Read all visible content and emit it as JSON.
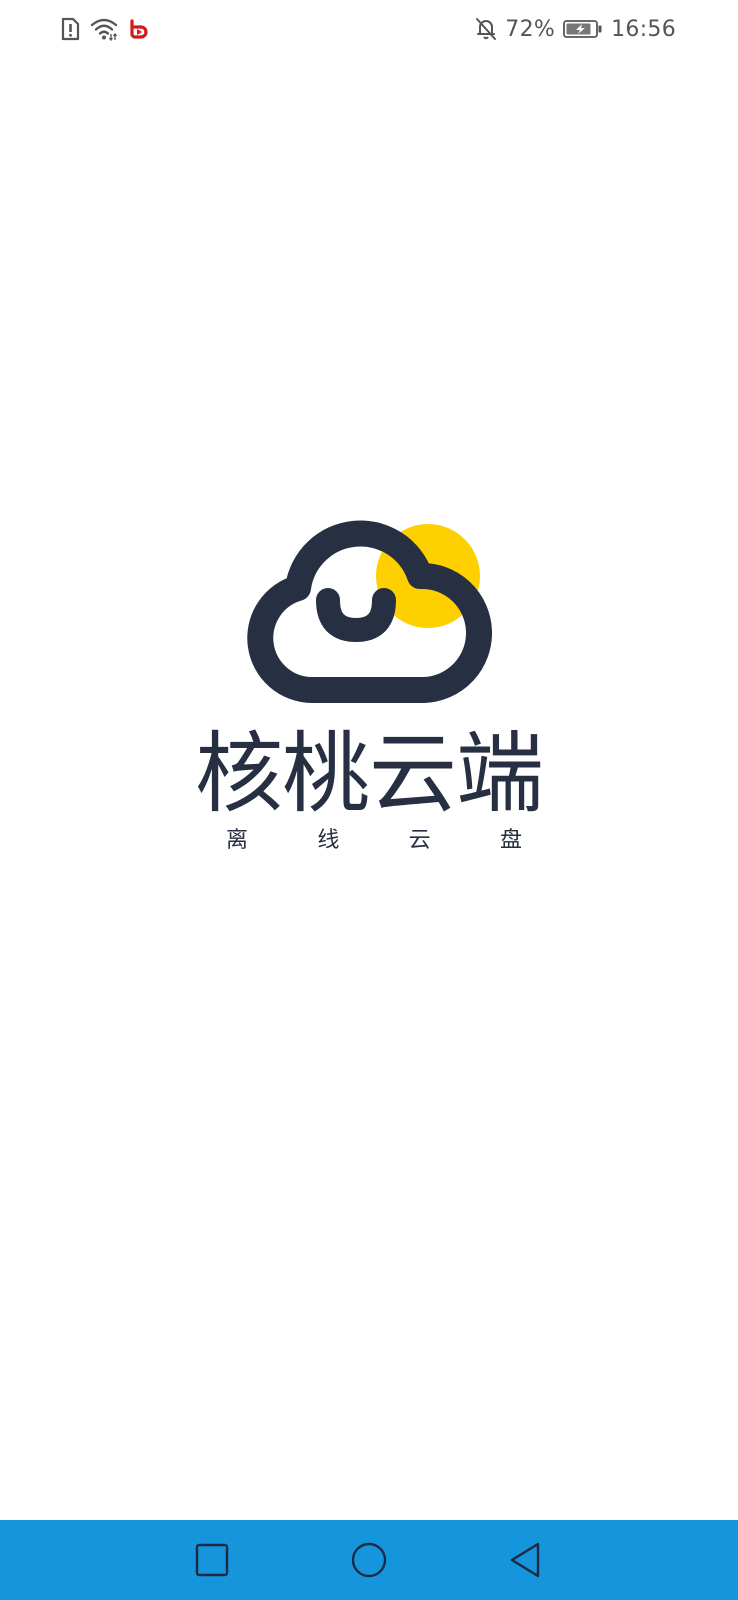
{
  "status_bar": {
    "battery_percent": "72%",
    "time": "16:56",
    "icons": [
      "sim-alert-icon",
      "wifi-icon",
      "app-notification-icon",
      "silent-bell-icon",
      "battery-charging-icon"
    ]
  },
  "splash": {
    "title": "核桃云端",
    "subtitle_chars": [
      "离",
      "线",
      "云",
      "盘"
    ],
    "colors": {
      "logo_dark": "#272f42",
      "logo_sun": "#ffd000"
    }
  },
  "nav_bar": {
    "background": "#1596dc",
    "buttons": [
      "recent-apps",
      "home",
      "back"
    ]
  }
}
